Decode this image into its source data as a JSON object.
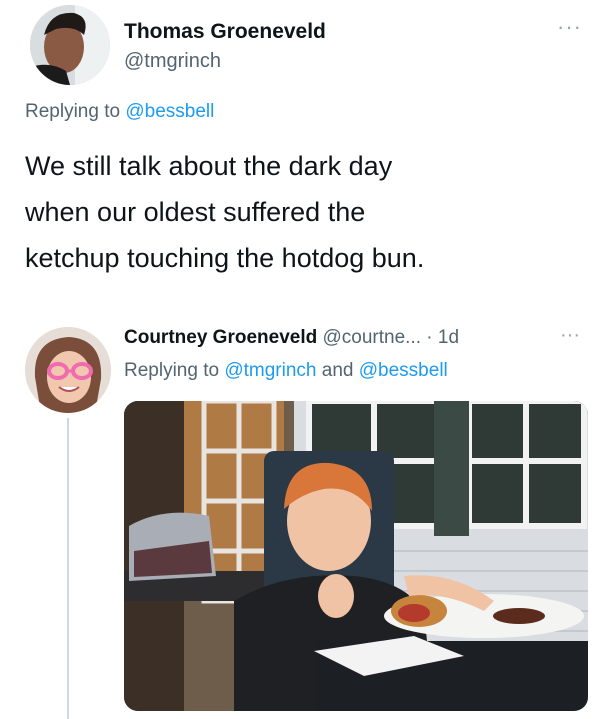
{
  "main_tweet": {
    "author_name": "Thomas Groeneveld",
    "author_handle": "@tmgrinch",
    "replying_prefix": "Replying to ",
    "replying_to": "@bessbell",
    "text_lines": [
      "We still talk about the dark day",
      "when our oldest suffered the",
      "ketchup touching the hotdog bun."
    ],
    "more_icon": "ellipsis-icon"
  },
  "reply_tweet": {
    "author_name": "Courtney Groeneveld",
    "author_handle": "@courtne...",
    "separator": " · ",
    "time": "1d",
    "replying_prefix": "Replying to ",
    "replying_to_1": "@tmgrinch",
    "replying_and": " and ",
    "replying_to_2": "@bessbell",
    "more_icon": "ellipsis-icon"
  },
  "colors": {
    "text": "#0f1419",
    "secondary": "#536471",
    "link": "#1d9bf0",
    "thread_line": "#cfd9de"
  }
}
